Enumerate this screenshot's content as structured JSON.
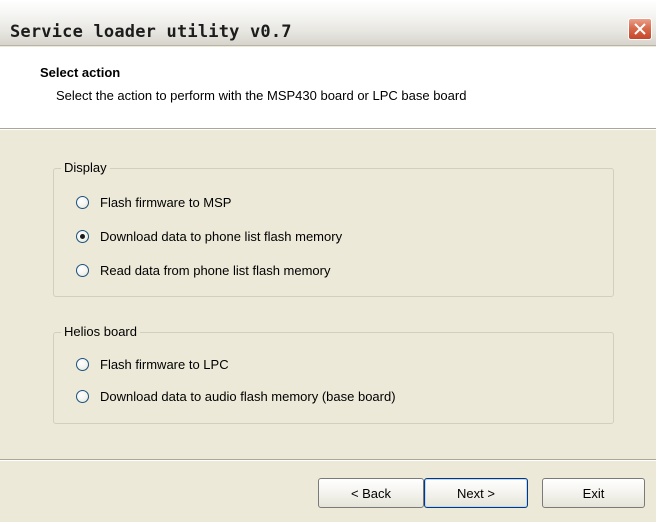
{
  "window": {
    "title": "Service loader utility v0.7"
  },
  "header": {
    "title": "Select action",
    "subtitle": "Select the action to perform with the MSP430 board or LPC base board"
  },
  "groups": [
    {
      "legend": "Display",
      "options": [
        {
          "label": "Flash firmware to MSP",
          "checked": false
        },
        {
          "label": "Download data to phone list flash memory",
          "checked": true
        },
        {
          "label": "Read data from phone list flash memory",
          "checked": false
        }
      ]
    },
    {
      "legend": "Helios board",
      "options": [
        {
          "label": "Flash firmware to LPC",
          "checked": false
        },
        {
          "label": "Download data to audio flash memory (base board)",
          "checked": false
        }
      ]
    }
  ],
  "buttons": {
    "back": "< Back",
    "next": "Next >",
    "exit": "Exit"
  },
  "colors": {
    "dialog_bg": "#ece9d8",
    "close_button": "#d96b4d",
    "default_button_border": "#003c74"
  }
}
